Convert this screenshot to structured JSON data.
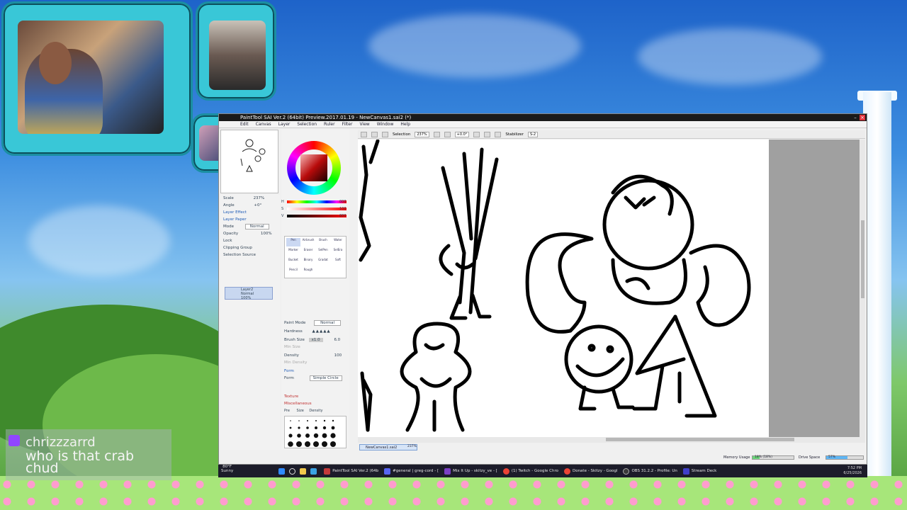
{
  "window": {
    "title": "PaintTool SAI Ver.2 (64bit) Preview.2017.01.19 - NewCanvas1.sai2 (*)"
  },
  "menu": [
    "Edit",
    "Canvas",
    "Layer",
    "Selection",
    "Ruler",
    "Filter",
    "View",
    "Window",
    "Help"
  ],
  "toolbar": {
    "selection_label": "Selection",
    "zoom": "237%",
    "angle": "+0.0°",
    "stabilizer_label": "Stabilizer",
    "stabilizer_value": "S-2"
  },
  "navigator": {
    "scale_label": "Scale",
    "scale_value": "237%",
    "angle_label": "Angle",
    "angle_value": "+0°"
  },
  "layer_panel": {
    "layer_effect": "Layer Effect",
    "layer_paper": "Layer Paper",
    "mode_label": "Mode",
    "mode_value": "Normal",
    "opacity_label": "Opacity",
    "opacity_value": "100%",
    "lock_label": "Lock",
    "clipping_group": "Clipping Group",
    "selection_source": "Selection Source",
    "layer_name": "Layer2",
    "layer_mode": "Normal",
    "layer_opacity": "100%"
  },
  "color_panel": {
    "h_label": "H",
    "h_value": "000",
    "s_label": "S",
    "s_value": "100",
    "v_label": "V",
    "v_value": "000"
  },
  "brush_tools": [
    "Pen",
    "Airbrush",
    "Brush",
    "Water",
    "Marker",
    "Eraser",
    "SelPen",
    "SelEra",
    "Bucket",
    "Binary",
    "Gradat",
    "Soft",
    "Pencil",
    "Rough"
  ],
  "tool_props": {
    "paint_mode_label": "Paint Mode",
    "paint_mode_value": "Normal",
    "hardness_label": "Hardness",
    "brush_size_label": "Brush Size",
    "brush_size_value": "x1.0",
    "brush_size_num": "6.0",
    "min_size_label": "Min Size",
    "density_label": "Density",
    "density_value": "100",
    "min_density_label": "Min Density",
    "form_section": "Form",
    "form_label": "Form",
    "form_value": "Simple Circle",
    "texture_section": "Texture",
    "misc_section": "Miscellaneous",
    "pre_label": "Pre",
    "size_label": "Size",
    "density_check": "Density"
  },
  "canvas": {
    "tab_label": "NewCanvas1.sai2",
    "tab_zoom": "237%"
  },
  "status": {
    "memory_label": "Memory Usage",
    "memory_value": "18% (18%)",
    "memory_fraction": 0.18,
    "drive_label": "Drive Space",
    "drive_value": "57%",
    "drive_fraction": 0.57
  },
  "taskbar": {
    "weather_temp": "80°F",
    "weather_desc": "Sunny",
    "apps": [
      {
        "label": "PaintTool SAI Ver.2 (64b",
        "color": "#c33a3a"
      },
      {
        "label": "#general | greg-cord - [",
        "color": "#5865f2"
      },
      {
        "label": "Mix It Up - skitzy_ve - [",
        "color": "#7b3fc4"
      },
      {
        "label": "(1) Twitch - Google Chro",
        "color": "#ea4335"
      },
      {
        "label": "Donate - Skitzy - Googl",
        "color": "#ea4335"
      },
      {
        "label": "OBS 31.2.2 - Profile: Un",
        "color": "#3a3a3a"
      },
      {
        "label": "Stream Deck",
        "color": "#4040c8"
      }
    ],
    "time": "7:52 PM",
    "date": "6/25/2026"
  },
  "chat": {
    "username": "chrizzzarrd",
    "message": "who is that crab chud"
  },
  "colors": {
    "twitch": "#9146ff",
    "cam_frame": "#39c7d7",
    "flower": "#ff9ccf"
  }
}
